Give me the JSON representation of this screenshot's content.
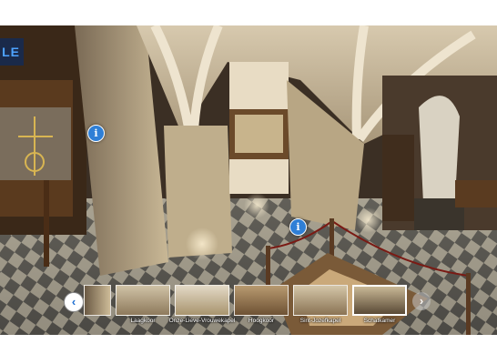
{
  "viewer": {
    "corner_label": "LE",
    "hotspot_glyph": "i",
    "prev_glyph": "‹",
    "next_glyph": "›"
  },
  "thumbnails": [
    {
      "caption": ""
    },
    {
      "caption": "Laagkoor"
    },
    {
      "caption": "Onze-Lieve-Vrouwekapel"
    },
    {
      "caption": "Hoogkoor"
    },
    {
      "caption": "Sint-Jozefkapel"
    },
    {
      "caption": "Schatkamer"
    }
  ],
  "colors": {
    "hotspot": "#2f7fd6",
    "accent": "#1f6fd1"
  }
}
